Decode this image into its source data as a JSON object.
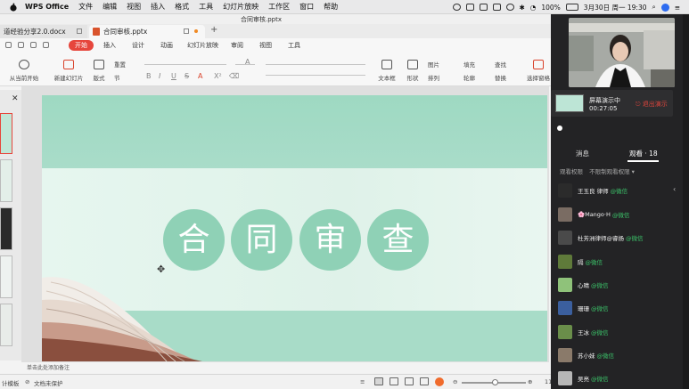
{
  "menubar": {
    "app": "WPS Office",
    "items": [
      "文件",
      "编辑",
      "视图",
      "插入",
      "格式",
      "工具",
      "幻灯片放映",
      "工作区",
      "窗口",
      "帮助"
    ],
    "battery": "100%",
    "datetime": "3月30日 周一 19:30"
  },
  "window_title": "合同审核.pptx",
  "tabs": [
    {
      "label": "道经验分享2.0.docx"
    },
    {
      "label": "合同审核.pptx"
    }
  ],
  "ribbon_tabs": {
    "start": "开始",
    "items": [
      "插入",
      "设计",
      "动画",
      "幻灯片放映",
      "审阅",
      "视图",
      "工具"
    ]
  },
  "toolbar": {
    "play_from_current": "从当前开始",
    "new_slide": "新建幻灯片",
    "layout": "版式",
    "reset": "重置",
    "section": "节",
    "textbox": "文本框",
    "shape": "形状",
    "image": "图片",
    "fill": "填充",
    "arrange": "排列",
    "outline": "轮廓",
    "find": "查找",
    "replace": "替换",
    "select_pane": "选择窗格"
  },
  "slide": {
    "title_chars": [
      "合",
      "同",
      "审",
      "查"
    ]
  },
  "notes_placeholder": "单击此处添加备注",
  "statusbar": {
    "left": "计模板",
    "protect": "文档未保护",
    "zoom_partial": "11"
  },
  "meeting": {
    "sharing_label": "屏幕演示中",
    "timer": "00:27:05",
    "exit_label": "退出演示",
    "tab_messages": "消息",
    "tab_viewers": "观看 · 18",
    "permission_label": "观看权限",
    "permission_value": "不限制观看权限",
    "wechat_tag": "@微信",
    "viewers": [
      {
        "name": "王玉良 律师",
        "color": "#2b2b2b"
      },
      {
        "name": "🌸Mango·H",
        "color": "#7a6c63"
      },
      {
        "name": "杜芳洲律师@睿扬",
        "color": "#4a4a4a"
      },
      {
        "name": "隔",
        "color": "#5f7a3a"
      },
      {
        "name": "心晴",
        "color": "#8fc27a"
      },
      {
        "name": "珊珊",
        "color": "#3b5f9e"
      },
      {
        "name": "王冰",
        "color": "#6a8e4a"
      },
      {
        "name": "苏小妹",
        "color": "#8a7a6a"
      },
      {
        "name": "吴亮",
        "color": "#b7b7b7"
      }
    ]
  }
}
